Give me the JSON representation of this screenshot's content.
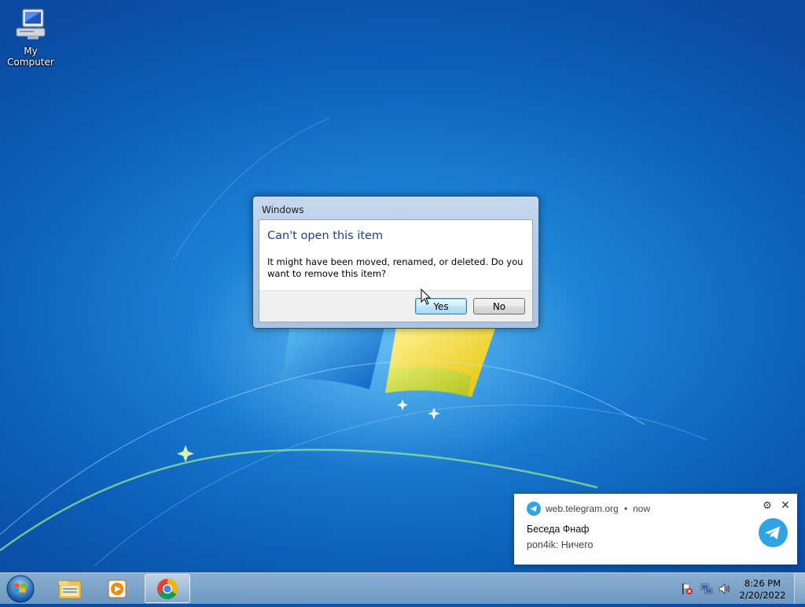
{
  "desktop": {
    "icons": [
      {
        "label": "My Computer",
        "icon": "computer-icon"
      }
    ]
  },
  "dialog": {
    "title": "Windows",
    "heading": "Can't open this item",
    "message": "It might have been moved, renamed, or deleted. Do you want to remove this item?",
    "buttons": {
      "yes": "Yes",
      "no": "No"
    }
  },
  "notification": {
    "source": "web.telegram.org",
    "separator": "•",
    "time": "now",
    "title": "Беседа Фнаф",
    "body": "pon4ik: Ничего",
    "settings_icon": "⚙",
    "close_icon": "✕",
    "accent": "#30a3e6"
  },
  "taskbar": {
    "items": [
      {
        "name": "windows-explorer",
        "icon": "folder-icon"
      },
      {
        "name": "media-player",
        "icon": "media-player-icon"
      },
      {
        "name": "chrome",
        "icon": "chrome-icon",
        "active": true
      }
    ],
    "tray": [
      "action-center-flag-icon",
      "network-icon",
      "volume-icon"
    ],
    "clock": {
      "time": "8:26 PM",
      "date": "2/20/2022"
    }
  }
}
